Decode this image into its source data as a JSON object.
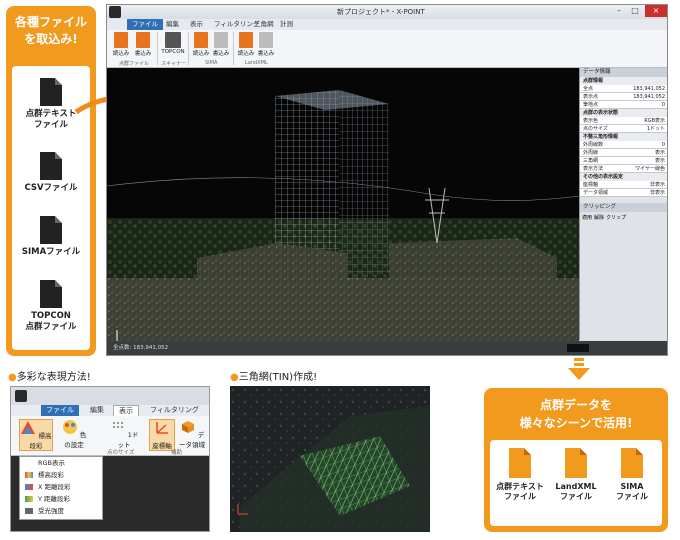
{
  "left_panel": {
    "title": "各種ファイル\nを取込み!",
    "files": [
      {
        "label": "点群テキスト\nファイル",
        "icon": "document-icon"
      },
      {
        "label": "CSVファイル",
        "icon": "document-icon"
      },
      {
        "label": "SIMAファイル",
        "icon": "document-icon"
      },
      {
        "label": "TOPCON\n点群ファイル",
        "icon": "document-icon"
      }
    ]
  },
  "main_window": {
    "title": "新プロジェクト* - X-POINT",
    "tabs": [
      "ファイル",
      "編集",
      "表示",
      "フィルタリング",
      "三角網",
      "計測"
    ],
    "ribbon_buttons": [
      "読込み",
      "書込み",
      "TOPCON",
      "読込み",
      "書込み",
      "読込み",
      "書込み"
    ],
    "ribbon_groups": [
      "点群ファイル",
      "スキャナー",
      "SIMA",
      "LandXML"
    ],
    "status_text": "全点数: 183,941,052",
    "side_panel": {
      "title": "データ情報",
      "sections": [
        {
          "name": "点群情報",
          "rows": [
            [
              "全点",
              "183,941,052"
            ],
            [
              "表示点",
              "183,941,052"
            ],
            [
              "筆地点",
              "0"
            ]
          ]
        },
        {
          "name": "点群の表示状態",
          "rows": [
            [
              "表示色",
              "RGB表示"
            ],
            [
              "点のサイズ",
              "1ドット"
            ]
          ]
        },
        {
          "name": "不整三角形情報",
          "rows": [
            [
              "外周線数",
              "0"
            ],
            [
              "外周線",
              "表示"
            ],
            [
              "三角網",
              "表示"
            ],
            [
              "表示方法",
              "ワイヤー線色"
            ]
          ]
        },
        {
          "name": "その他の表示設定",
          "rows": [
            [
              "座標軸",
              "非表示"
            ],
            [
              "データ領域",
              "非表示"
            ]
          ]
        }
      ],
      "clipping_title": "クリッピング",
      "clipping_buttons": [
        "適用",
        "解除",
        "クリップ"
      ]
    }
  },
  "section_express": {
    "title": "多彩な表現方法!",
    "window": {
      "tabs": [
        "ファイル",
        "編集",
        "表示",
        "フィルタリング"
      ],
      "buttons": [
        "標高段彩",
        "色の設定",
        "1ドット",
        "座標軸",
        "データ領域"
      ],
      "groups": [
        "点のサイズ",
        "補助"
      ],
      "dropdown_items": [
        "RGB表示",
        "標高段彩",
        "X 距離段彩",
        "Y 距離段彩",
        "受光強度"
      ]
    }
  },
  "section_tin": {
    "title": "三角網(TIN)作成!"
  },
  "right_panel": {
    "title": "点群データを\n様々なシーンで活用!",
    "files": [
      {
        "label": "点群テキスト\nファイル",
        "icon": "document-icon"
      },
      {
        "label": "LandXML\nファイル",
        "icon": "document-icon"
      },
      {
        "label": "SIMA\nファイル",
        "icon": "document-icon"
      }
    ]
  },
  "colors": {
    "accent": "#f29a1e",
    "ribbon_tab": "#2f6fb5"
  }
}
